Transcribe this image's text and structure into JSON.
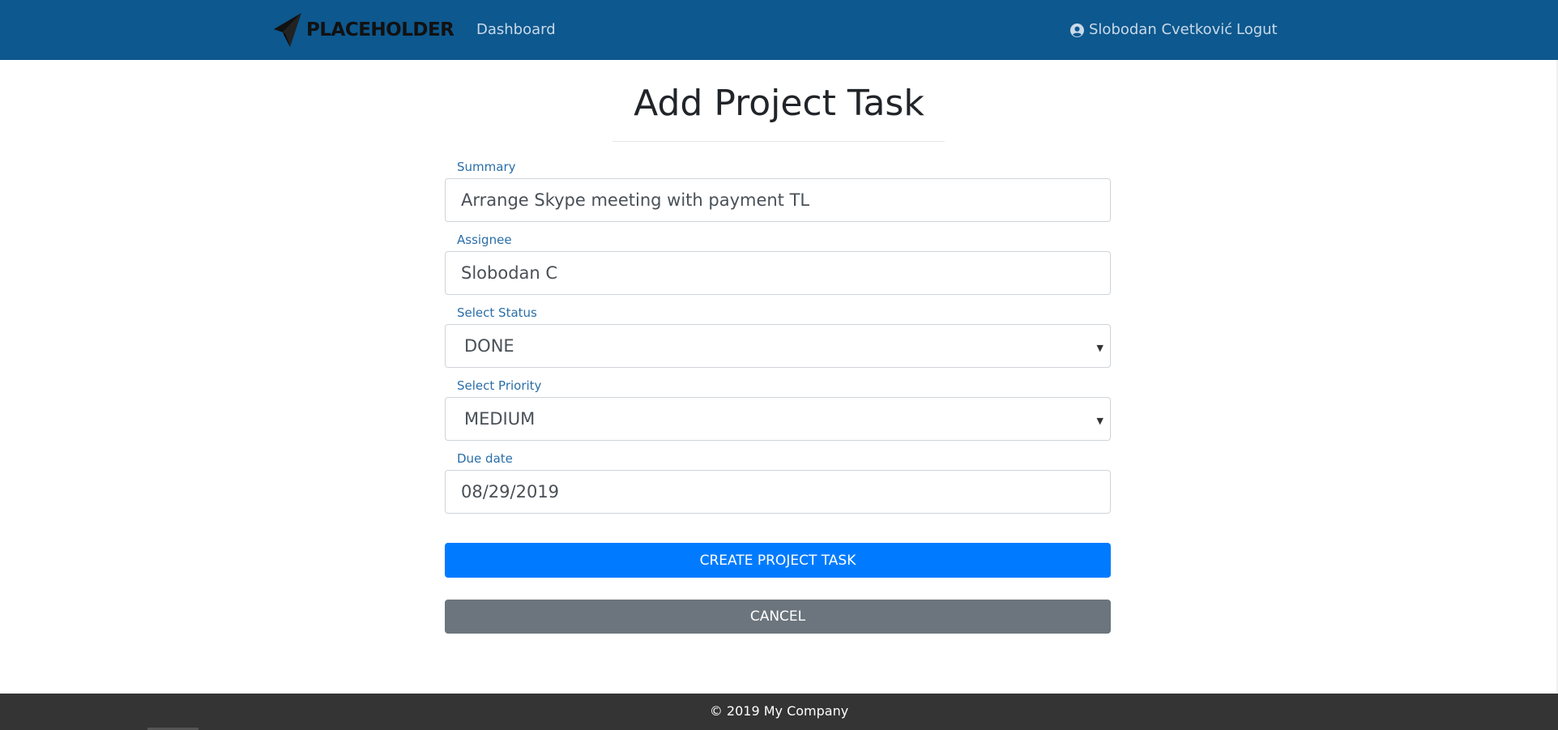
{
  "navbar": {
    "brand": "PLACEHOLDER",
    "brand_logo_icon": "paper-plane-logo-icon",
    "dashboard_link": "Dashboard",
    "user_icon": "user-circle-icon",
    "user_name": "Slobodan Cvetković",
    "logout_link": "Logut"
  },
  "form": {
    "title": "Add Project Task",
    "summary": {
      "label": "Summary",
      "value": "Arrange Skype meeting with payment TL"
    },
    "assignee": {
      "label": "Assignee",
      "value": "Slobodan C"
    },
    "status": {
      "label": "Select Status",
      "value": "DONE"
    },
    "priority": {
      "label": "Select Priority",
      "value": "MEDIUM"
    },
    "due_date": {
      "label": "Due date",
      "value": "08/29/2019"
    },
    "create_button": "CREATE PROJECT TASK",
    "cancel_button": "CANCEL"
  },
  "footer": {
    "text": "© 2019 My Company"
  },
  "colors": {
    "navbar": "#0d588e",
    "primary": "#007bff",
    "secondary": "#6c757d",
    "footer": "#343434",
    "label": "#2a6ea8"
  }
}
